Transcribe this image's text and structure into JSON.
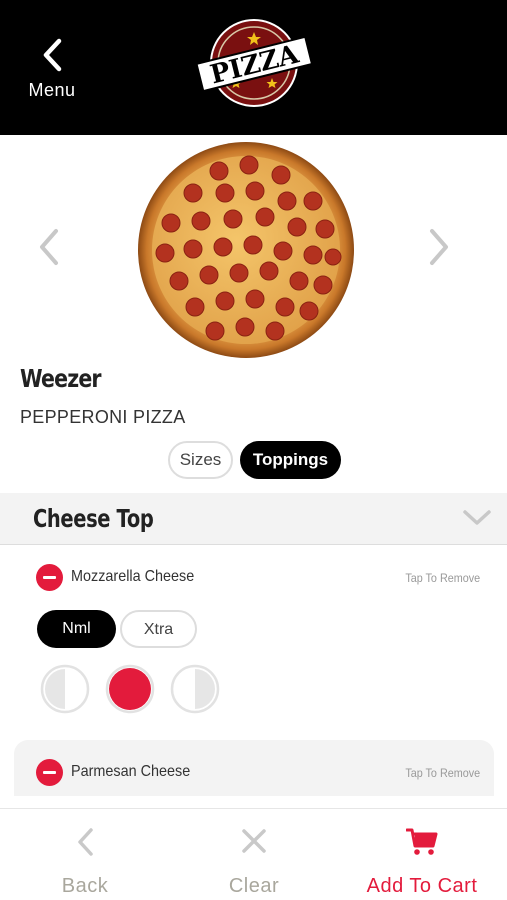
{
  "header": {
    "menu_label": "Menu",
    "logo_text": "PIZZA"
  },
  "product": {
    "name": "Weezer",
    "type": "PEPPERONI PIZZA"
  },
  "tabs": {
    "sizes_label": "Sizes",
    "toppings_label": "Toppings",
    "selected": "Toppings"
  },
  "section": {
    "title": "Cheese Top"
  },
  "toppings": [
    {
      "name": "Mozzarella Cheese",
      "action": "Tap To Remove",
      "amount_options": [
        "Nml",
        "Xtra"
      ],
      "selected_amount": "Nml",
      "portion_selected": "whole"
    },
    {
      "name": "Parmesan Cheese",
      "action": "Tap To Remove"
    }
  ],
  "bottom_bar": {
    "back_label": "Back",
    "clear_label": "Clear",
    "cart_label": "Add To Cart"
  },
  "colors": {
    "accent_red": "#e31b3c",
    "header_bg": "#000000",
    "muted_label": "#a9a79d"
  },
  "icons": {
    "menu": "chevron-left-icon",
    "prev_image": "chevron-left-icon",
    "next_image": "chevron-right-icon",
    "section_toggle": "chevron-down-icon",
    "remove": "minus-circle-icon",
    "back": "chevron-left-icon",
    "clear": "close-icon",
    "cart": "cart-icon"
  }
}
